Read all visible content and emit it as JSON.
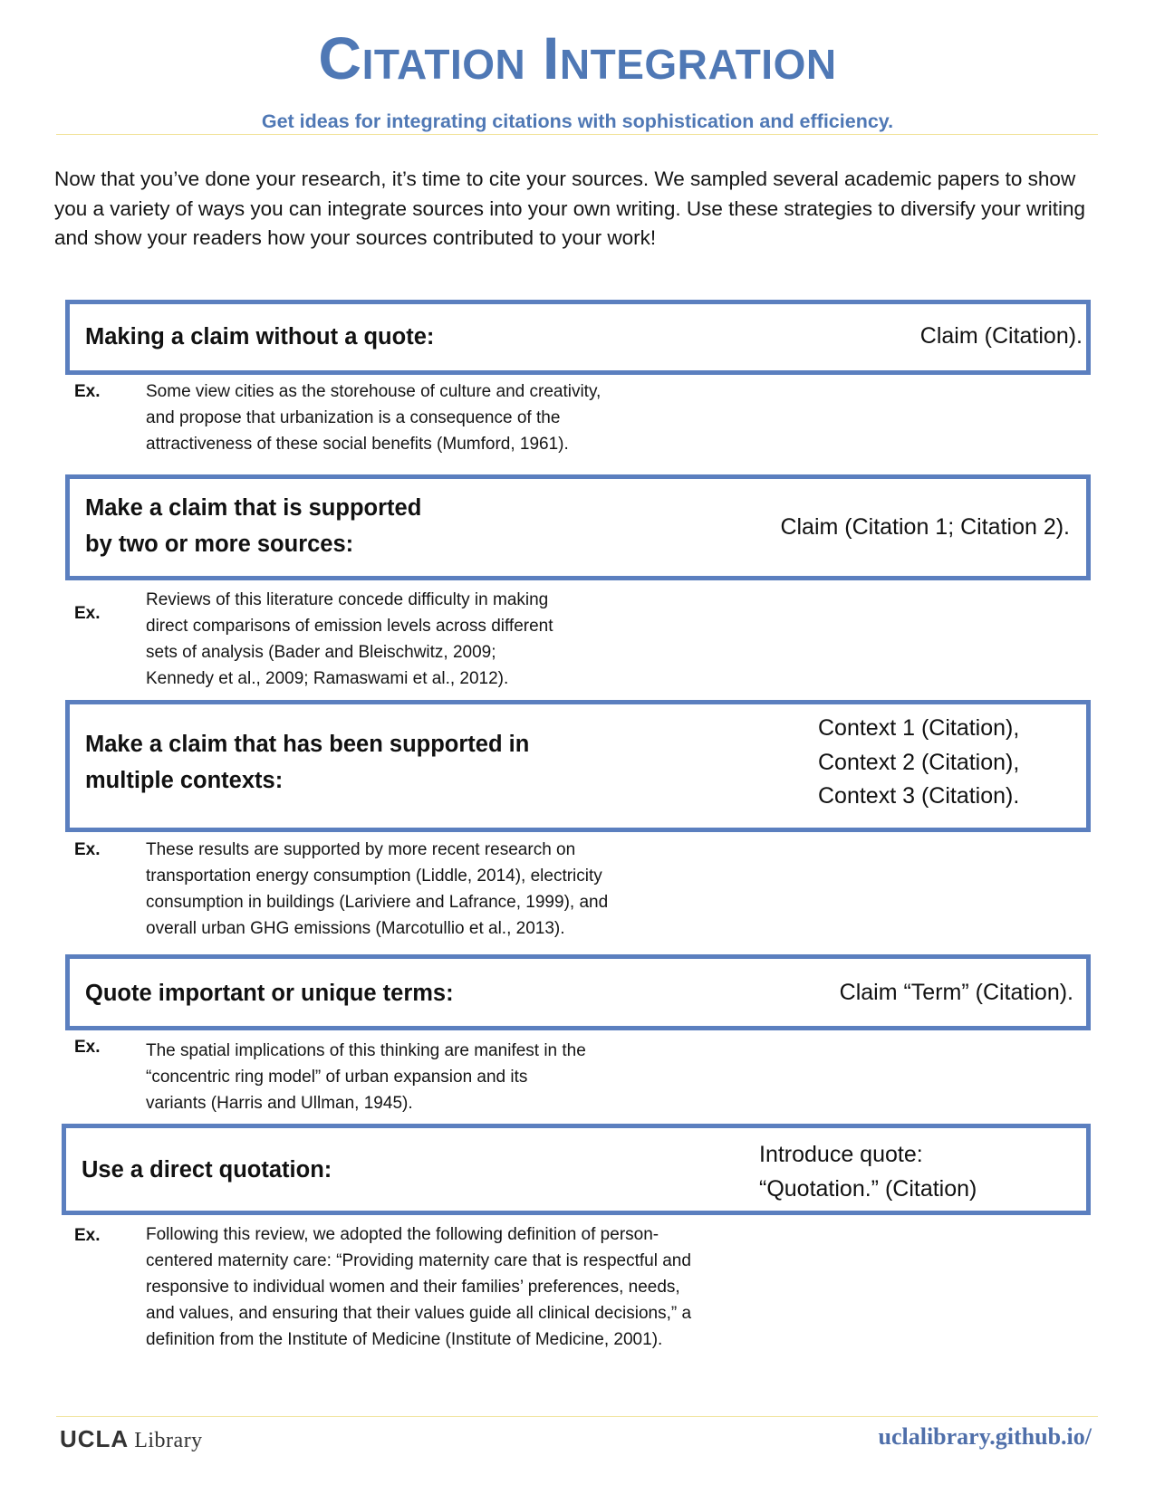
{
  "header": {
    "title": "Citation Integration",
    "subtitle": "Get ideas for integrating citations with sophistication and efficiency."
  },
  "intro": "Now that you’ve done your research, it’s time to cite your sources. We sampled several academic papers to show you a variety of ways you can integrate sources into your own writing. Use these strategies to diversify your writing and show your readers how your sources contributed to your work!",
  "ex_label": "Ex.",
  "sections": [
    {
      "title": "Making a claim without a quote:",
      "formula": [
        "Claim (Citation)."
      ],
      "example": [
        "Some view cities as the storehouse of culture and creativity,",
        "and propose that urbanization is a consequence of the",
        "attractiveness of these social benefits (Mumford, 1961)."
      ]
    },
    {
      "title": [
        "Make a claim that is supported",
        "by two or more sources:"
      ],
      "formula": [
        "Claim (Citation 1; Citation 2)."
      ],
      "example": [
        "Reviews of this literature concede difficulty in making",
        "direct comparisons of emission levels across different",
        "sets of analysis (Bader and Bleischwitz, 2009;",
        "Kennedy et al., 2009; Ramaswami et al., 2012)."
      ]
    },
    {
      "title": [
        "Make a claim that has been supported in",
        "multiple contexts:"
      ],
      "formula": [
        "Context 1 (Citation),",
        "Context 2 (Citation),",
        "Context 3 (Citation)."
      ],
      "example": [
        "These results are supported by more recent research on",
        "transportation energy consumption (Liddle, 2014), electricity",
        "consumption in buildings (Lariviere and Lafrance, 1999), and",
        "overall urban GHG emissions (Marcotullio et al., 2013)."
      ]
    },
    {
      "title": "Quote important or unique terms:",
      "formula": [
        "Claim “Term” (Citation)."
      ],
      "example": [
        "The spatial implications of this thinking are manifest in the",
        "“concentric ring model” of urban expansion and its",
        "variants (Harris and Ullman, 1945)."
      ]
    },
    {
      "title": "Use a direct quotation:",
      "formula": [
        "Introduce quote:",
        "“Quotation.” (Citation)"
      ],
      "example": [
        "Following this review, we adopted the following definition of person-",
        "centered maternity care: “Providing maternity care that is respectful and",
        "responsive to individual women and their families’ preferences, needs,",
        "and values, and ensuring that their values guide all clinical decisions,” a",
        "definition from the Institute of Medicine (Institute of Medicine, 2001)."
      ]
    }
  ],
  "footer": {
    "logo_bold": "UCLA",
    "logo_light": "Library",
    "url": "uclalibrary.github.io/"
  },
  "colors": {
    "accent": "#4f78b5",
    "box_border": "#5b7fbf",
    "rule": "#f1e39b"
  }
}
